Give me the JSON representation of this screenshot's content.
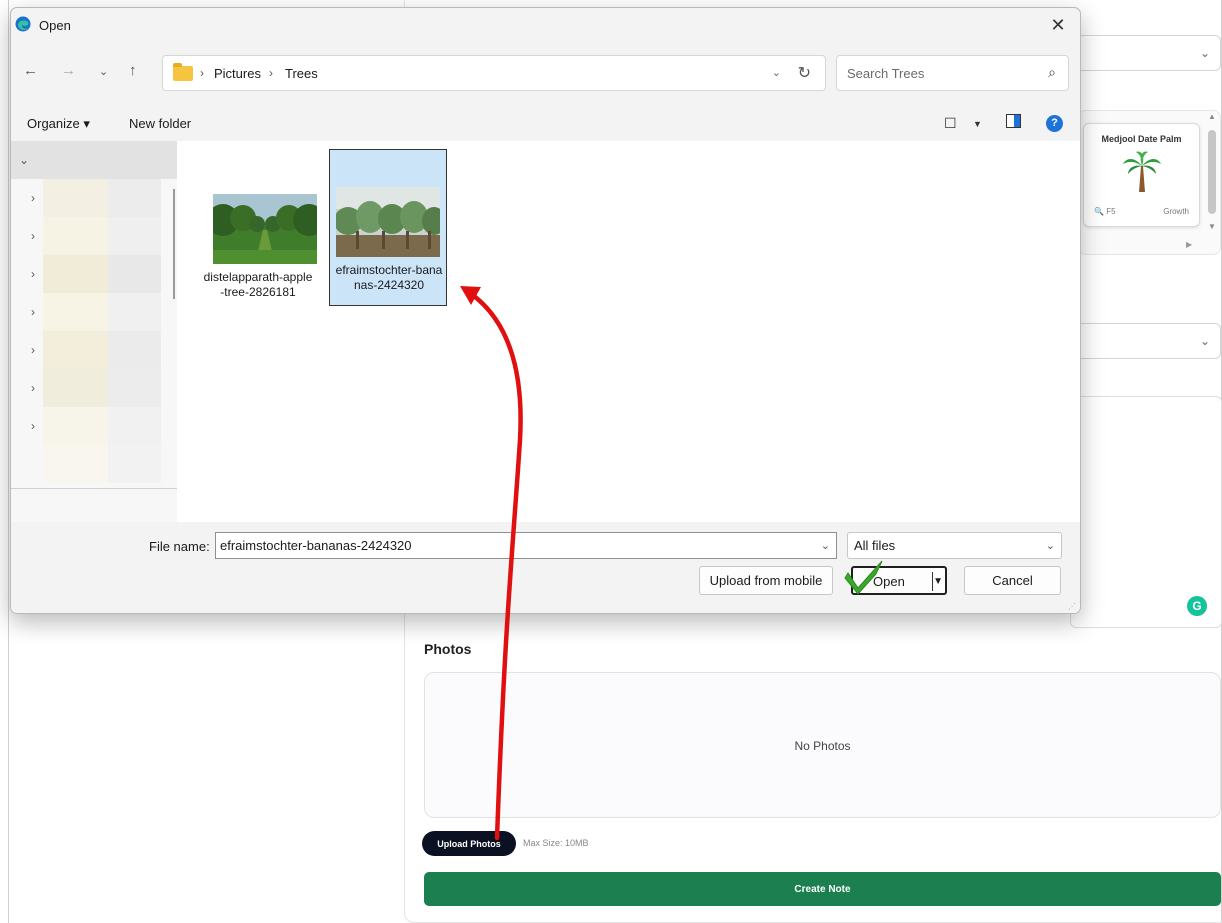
{
  "background": {
    "tree_card": {
      "title": "Medjool Date Palm",
      "code": "F5",
      "growth": "Growth"
    },
    "photos_label": "Photos",
    "no_photos_text": "No Photos",
    "upload_button": "Upload Photos",
    "max_size": "Max Size: 10MB",
    "create_button": "Create Note",
    "grammarly_icon": "G"
  },
  "dialog": {
    "title": "Open",
    "close_glyph": "✕",
    "breadcrumb": [
      "Pictures",
      "Trees"
    ],
    "search_placeholder": "Search Trees",
    "toolbar": {
      "organize": "Organize ▾",
      "new_folder": "New folder",
      "help": "?"
    },
    "files": [
      {
        "name": "distelapparath-apple-tree-2826181",
        "selected": false,
        "icon": "apple-orchard-thumbnail"
      },
      {
        "name": "efraimstochter-bananas-2424320",
        "selected": true,
        "icon": "banana-plantation-thumbnail"
      }
    ],
    "file_name_label": "File name:",
    "file_name_value": "efraimstochter-bananas-2424320",
    "file_type": "All files",
    "buttons": {
      "upload_mobile": "Upload from mobile",
      "open": "Open",
      "cancel": "Cancel"
    }
  },
  "colors": {
    "accent_green": "#1b7f4f",
    "annotation_red": "#e01010",
    "check_green": "#3aa82a",
    "selection_blue": "#cce4f7"
  }
}
